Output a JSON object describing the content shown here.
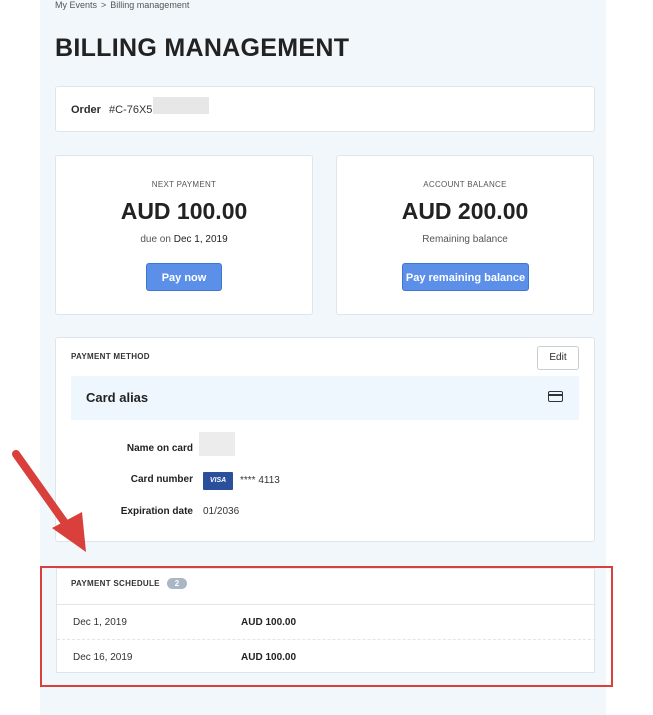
{
  "breadcrumb": {
    "items": [
      "My Events",
      ">",
      "Billing management"
    ]
  },
  "page_title": "BILLING MANAGEMENT",
  "order": {
    "label": "Order",
    "id": "#C-76X5"
  },
  "next_payment": {
    "label": "NEXT PAYMENT",
    "amount": "AUD 100.00",
    "due_prefix": "due on",
    "due_date": "Dec 1, 2019",
    "button": "Pay now"
  },
  "account_balance": {
    "label": "ACCOUNT BALANCE",
    "amount": "AUD 200.00",
    "sub": "Remaining balance",
    "button": "Pay remaining balance"
  },
  "payment_method": {
    "title": "PAYMENT METHOD",
    "edit": "Edit",
    "alias": "Card alias",
    "name_label": "Name on card",
    "number_label": "Card number",
    "card_brand": "VISA",
    "card_number": "**** 4113",
    "expiry_label": "Expiration date",
    "expiry": "01/2036"
  },
  "schedule": {
    "title": "PAYMENT SCHEDULE",
    "count": "2",
    "rows": [
      {
        "date": "Dec 1, 2019",
        "amount": "AUD 100.00"
      },
      {
        "date": "Dec 16, 2019",
        "amount": "AUD 100.00"
      }
    ]
  },
  "colors": {
    "accent": "#5b8fe8",
    "highlight": "#d9403b",
    "panel": "#f1f7fb",
    "visa": "#2a4f9b"
  }
}
